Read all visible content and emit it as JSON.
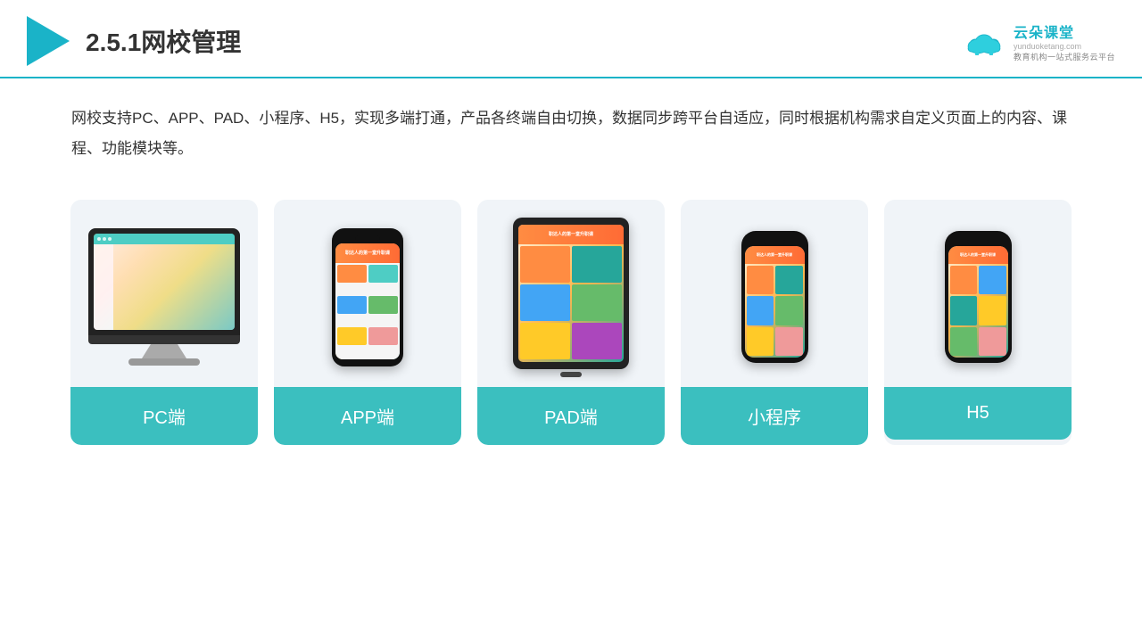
{
  "header": {
    "title": "2.5.1网校管理",
    "brand_name": "云朵课堂",
    "brand_url": "yunduoketang.com",
    "brand_tagline": "教育机构一站",
    "brand_tagline2": "式服务云平台"
  },
  "description": {
    "text": "网校支持PC、APP、PAD、小程序、H5，实现多端打通，产品各终端自由切换，数据同步跨平台自适应，同时根据机构需求自定义页面上的内容、课程、功能模块等。"
  },
  "cards": [
    {
      "label": "PC端",
      "type": "pc"
    },
    {
      "label": "APP端",
      "type": "phone"
    },
    {
      "label": "PAD端",
      "type": "tablet"
    },
    {
      "label": "小程序",
      "type": "mini-phone"
    },
    {
      "label": "H5",
      "type": "mini-phone2"
    }
  ]
}
